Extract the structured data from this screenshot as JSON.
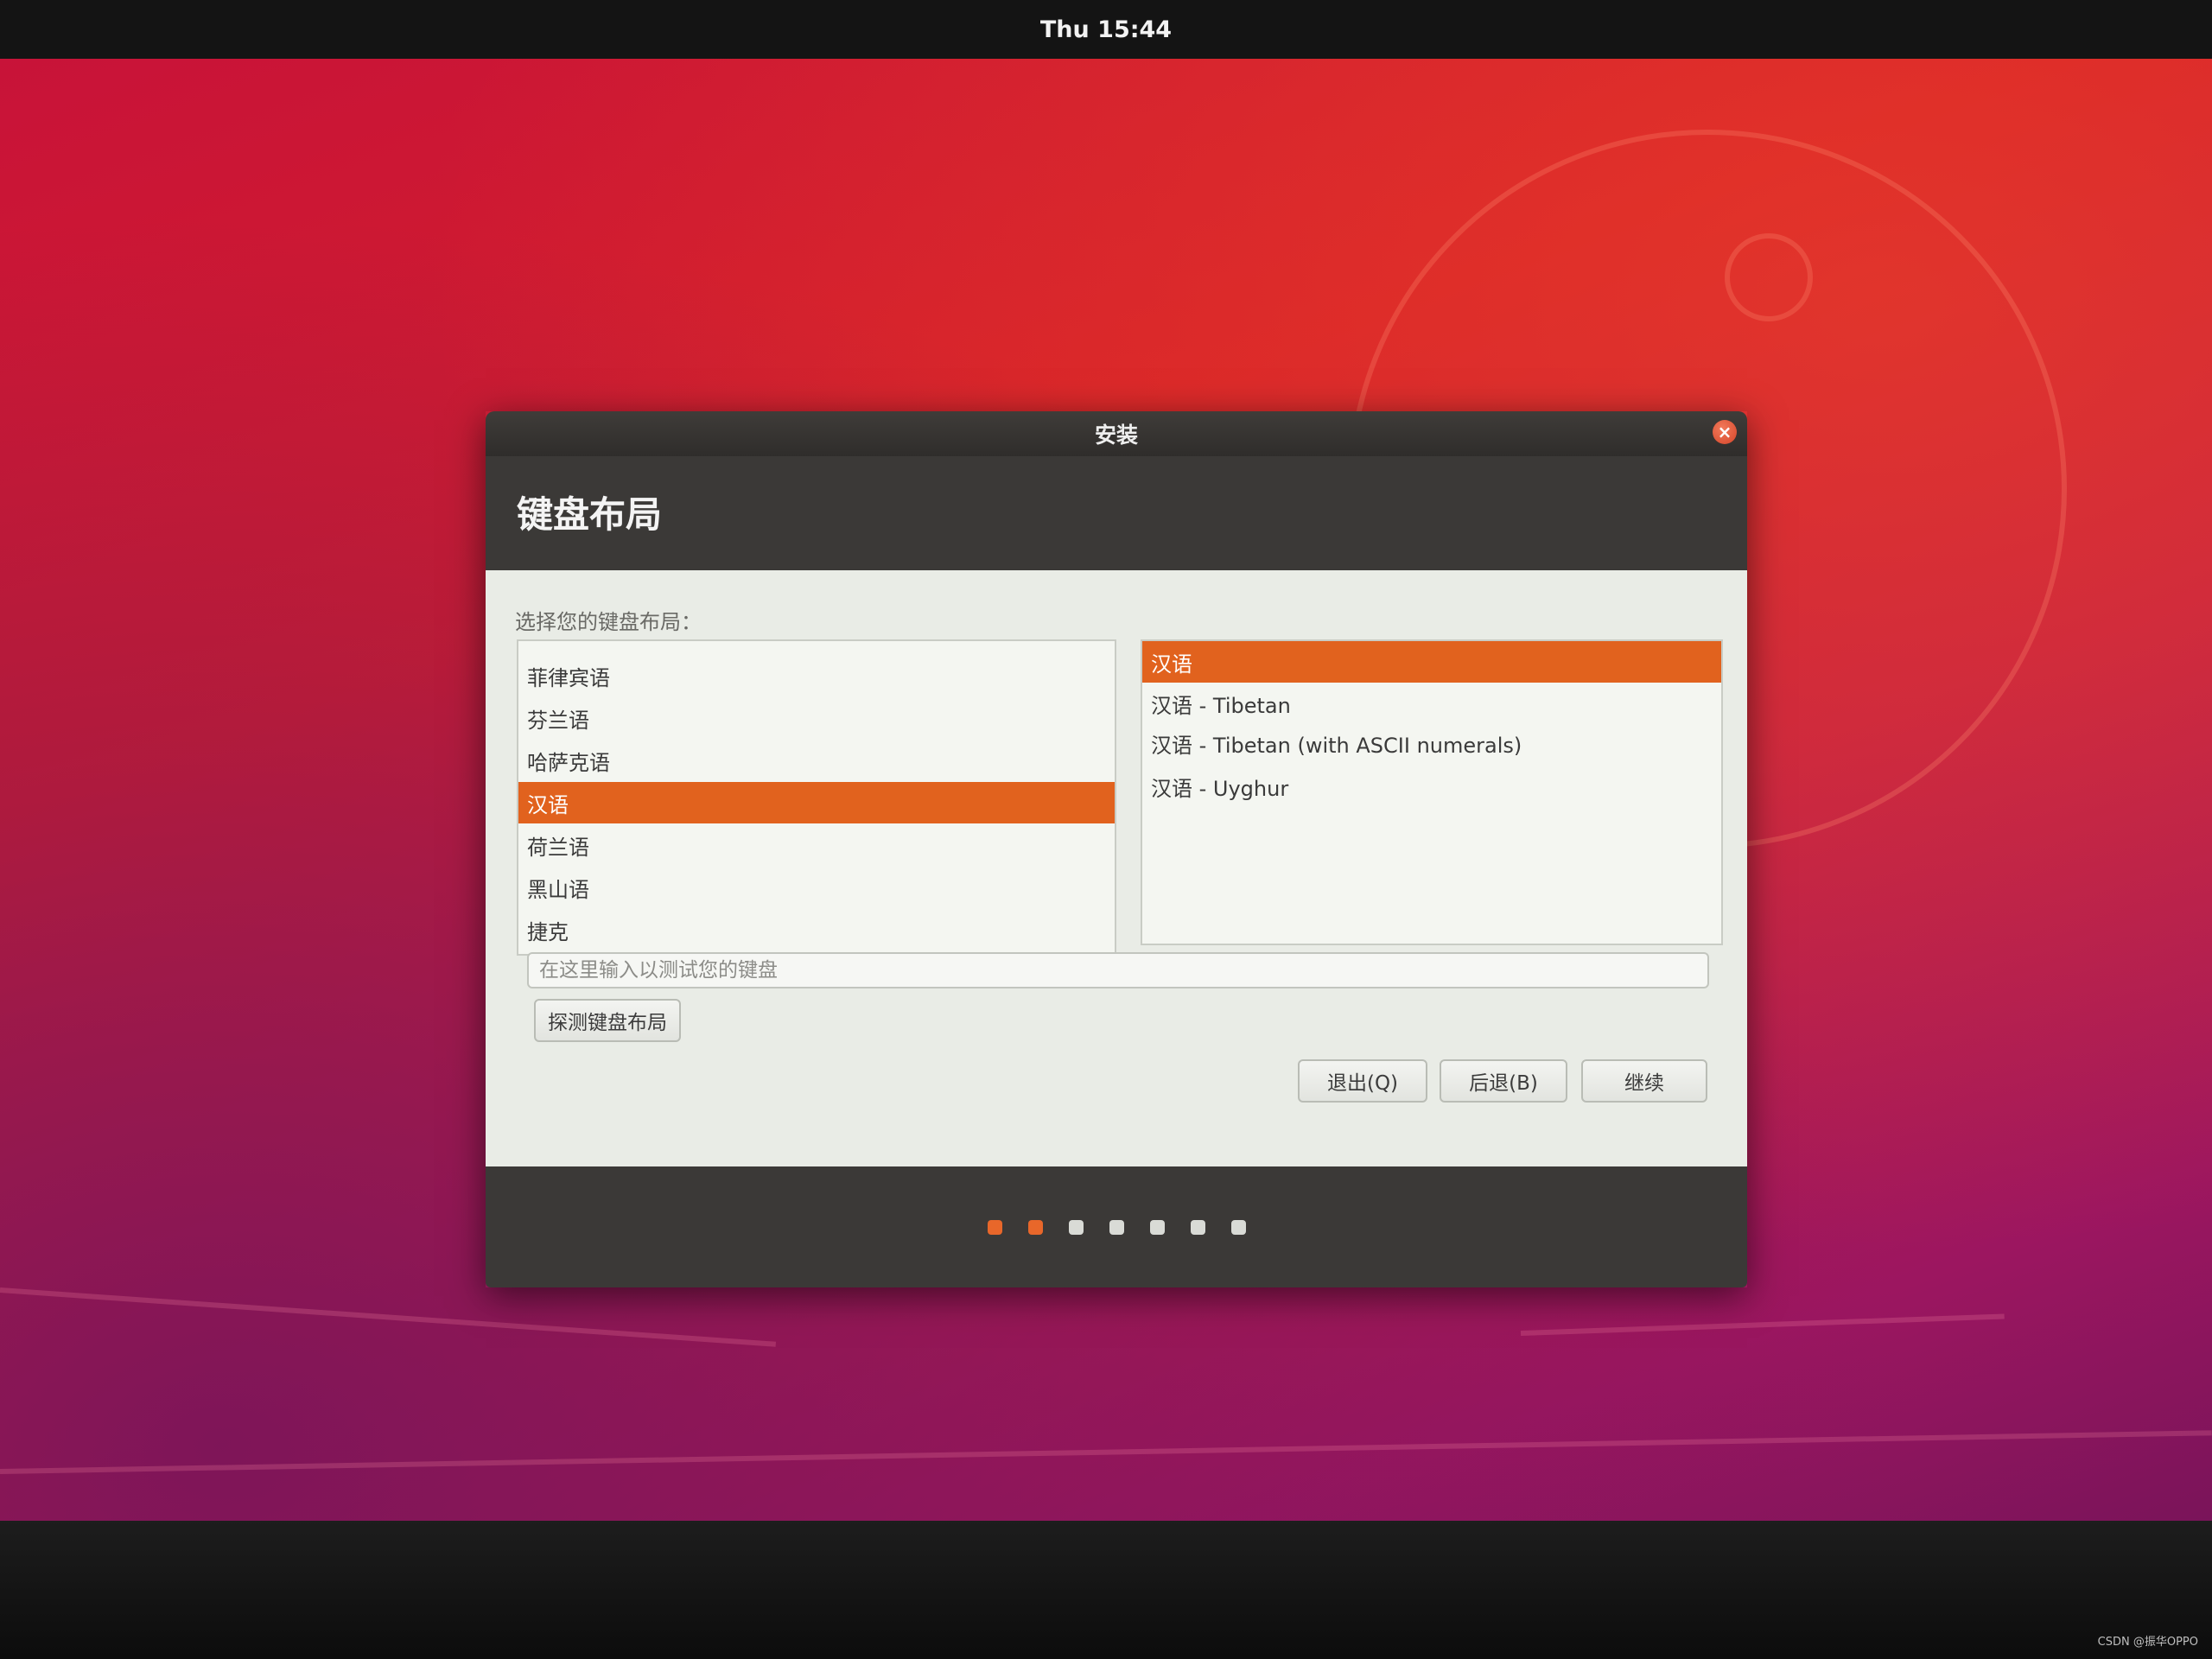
{
  "topbar": {
    "clock": "Thu 15:44"
  },
  "window": {
    "title": "安装",
    "close_icon": "close-icon"
  },
  "page": {
    "title": "键盘布局",
    "prompt": "选择您的键盘布局："
  },
  "layouts": {
    "items": [
      {
        "label": "菲律宾语",
        "selected": false
      },
      {
        "label": "芬兰语",
        "selected": false
      },
      {
        "label": "哈萨克语",
        "selected": false
      },
      {
        "label": "汉语",
        "selected": true
      },
      {
        "label": "荷兰语",
        "selected": false
      },
      {
        "label": "黑山语",
        "selected": false
      },
      {
        "label": "捷克",
        "selected": false
      }
    ]
  },
  "variants": {
    "items": [
      {
        "label": "汉语",
        "selected": true
      },
      {
        "label": "汉语 - Tibetan",
        "selected": false
      },
      {
        "label": "汉语 - Tibetan (with ASCII numerals)",
        "selected": false
      },
      {
        "label": "汉语 - Uyghur",
        "selected": false
      }
    ]
  },
  "test": {
    "placeholder": "在这里输入以测试您的键盘",
    "value": ""
  },
  "buttons": {
    "detect": "探测键盘布局",
    "quit": "退出(Q)",
    "back": "后退(B)",
    "continue": "继续"
  },
  "progress": {
    "total_steps": 7,
    "current_step": 2
  },
  "colors": {
    "accent": "#e1621e",
    "header": "#3b3937",
    "background": "#c7123a"
  },
  "watermark": "CSDN @振华OPPO"
}
